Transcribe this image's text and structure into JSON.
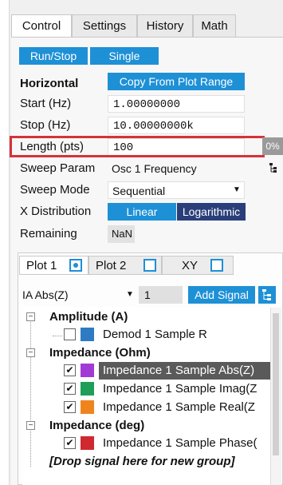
{
  "tabs": [
    "Control",
    "Settings",
    "History",
    "Math"
  ],
  "run_stop": "Run/Stop",
  "single": "Single",
  "horizontal": {
    "heading": "Horizontal",
    "copy_btn": "Copy From Plot Range",
    "start_label": "Start (Hz)",
    "start_value": "1.00000000",
    "stop_label": "Stop (Hz)",
    "stop_value": "10.00000000k",
    "length_label": "Length (pts)",
    "length_value": "100",
    "progress_text": "0%",
    "progress": 0
  },
  "sweep_param_label": "Sweep Param",
  "sweep_param_value": "Osc 1 Frequency",
  "sweep_mode_label": "Sweep Mode",
  "sweep_mode_value": "Sequential",
  "x_dist_label": "X Distribution",
  "x_dist_linear": "Linear",
  "x_dist_log": "Logarithmic",
  "remaining_label": "Remaining",
  "remaining_value": "NaN",
  "plot_tabs": [
    "Plot 1",
    "Plot 2",
    "XY"
  ],
  "signal_select": "IA Abs(Z)",
  "signal_index": "1",
  "add_signal": "Add Signal",
  "tree": {
    "group1": "Amplitude (A)",
    "g1_item1": "Demod 1 Sample R",
    "group2": "Impedance (Ohm)",
    "g2_item1": "Impedance 1 Sample Abs(Z)",
    "g2_item2": "Impedance 1 Sample Imag(Z",
    "g2_item3": "Impedance 1 Sample Real(Z",
    "group3": "Impedance (deg)",
    "g3_item1": "Impedance 1 Sample Phase(",
    "drop_text": "[Drop signal here for new group]"
  },
  "colors": {
    "accent": "#1e90d6",
    "highlight": "#d6323a",
    "dark_selected": "#2a3f7a",
    "swatch_r": "#2e7bc4",
    "swatch_abs": "#a23bd6",
    "swatch_imag": "#1f9e5a",
    "swatch_real": "#f0841c",
    "swatch_phase": "#d0282f"
  }
}
